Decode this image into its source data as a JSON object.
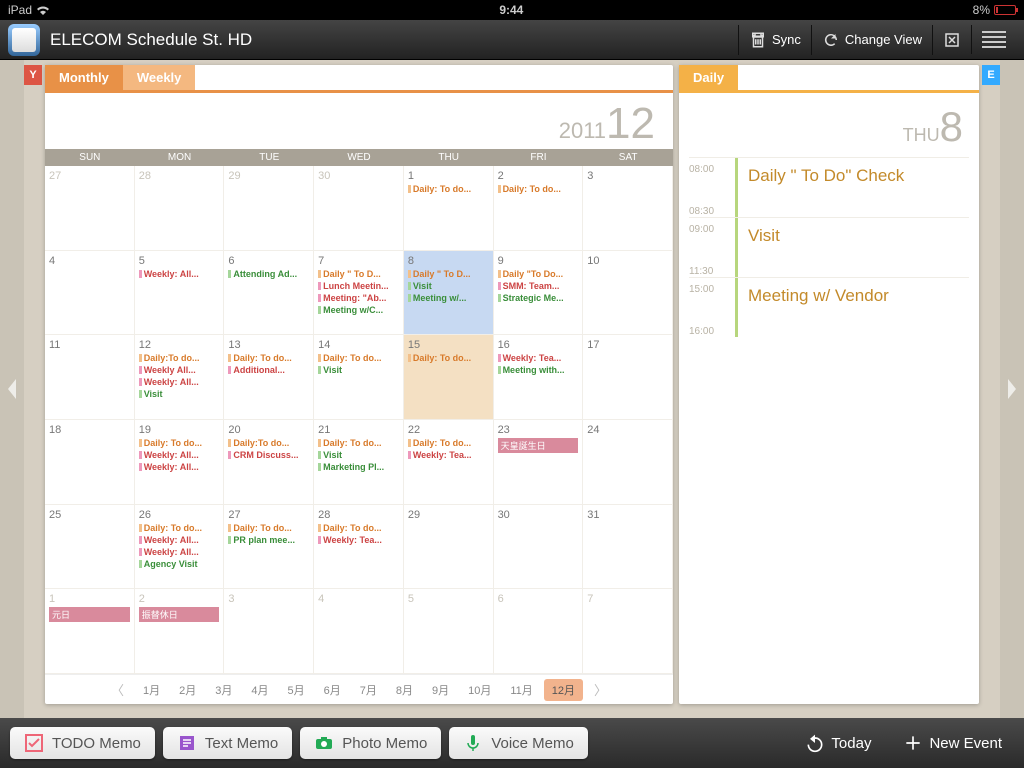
{
  "status": {
    "device": "iPad",
    "time": "9:44",
    "battery": "8%"
  },
  "header": {
    "title": "ELECOM Schedule St. HD",
    "sync": "Sync",
    "change_view": "Change View"
  },
  "left_tab": "Y",
  "right_tab": "E",
  "month": {
    "tabs": {
      "monthly": "Monthly",
      "weekly": "Weekly"
    },
    "year": "2011",
    "mon": "12",
    "dow": [
      "SUN",
      "MON",
      "TUE",
      "WED",
      "THU",
      "FRI",
      "SAT"
    ],
    "nav": [
      "1月",
      "2月",
      "3月",
      "4月",
      "5月",
      "6月",
      "7月",
      "8月",
      "9月",
      "10月",
      "11月",
      "12月"
    ],
    "cells": [
      {
        "n": "27",
        "dim": true
      },
      {
        "n": "28",
        "dim": true
      },
      {
        "n": "29",
        "dim": true
      },
      {
        "n": "30",
        "dim": true
      },
      {
        "n": "1",
        "ev": [
          {
            "c": "ora",
            "t": "Daily: To do..."
          }
        ]
      },
      {
        "n": "2",
        "ev": [
          {
            "c": "ora",
            "t": "Daily: To do..."
          }
        ]
      },
      {
        "n": "3"
      },
      {
        "n": "4"
      },
      {
        "n": "5",
        "ev": [
          {
            "c": "red",
            "t": "Weekly: All..."
          }
        ]
      },
      {
        "n": "6",
        "ev": [
          {
            "c": "grn",
            "t": "Attending Ad..."
          }
        ]
      },
      {
        "n": "7",
        "ev": [
          {
            "c": "ora",
            "t": "Daily \" To D..."
          },
          {
            "c": "red",
            "t": "Lunch Meetin..."
          },
          {
            "c": "red",
            "t": "Meeting: \"Ab..."
          },
          {
            "c": "grn",
            "t": "Meeting w/C..."
          }
        ]
      },
      {
        "n": "8",
        "sel": true,
        "ev": [
          {
            "c": "ora",
            "t": "Daily \" To D..."
          },
          {
            "c": "grn",
            "t": "Visit"
          },
          {
            "c": "grn",
            "t": "Meeting w/..."
          }
        ]
      },
      {
        "n": "9",
        "ev": [
          {
            "c": "ora",
            "t": "Daily \"To Do..."
          },
          {
            "c": "red",
            "t": "SMM: Team..."
          },
          {
            "c": "grn",
            "t": "Strategic Me..."
          }
        ]
      },
      {
        "n": "10"
      },
      {
        "n": "11"
      },
      {
        "n": "12",
        "ev": [
          {
            "c": "ora",
            "t": "Daily:To do..."
          },
          {
            "c": "red",
            "t": "Weekly All..."
          },
          {
            "c": "red",
            "t": "Weekly: All..."
          },
          {
            "c": "grn",
            "t": "Visit"
          }
        ]
      },
      {
        "n": "13",
        "ev": [
          {
            "c": "ora",
            "t": "Daily: To do..."
          },
          {
            "c": "red",
            "t": "Additional..."
          }
        ]
      },
      {
        "n": "14",
        "ev": [
          {
            "c": "ora",
            "t": "Daily: To do..."
          },
          {
            "c": "grn",
            "t": "Visit"
          }
        ]
      },
      {
        "n": "15",
        "shade": true,
        "ev": [
          {
            "c": "ora",
            "t": "Daily: To do..."
          }
        ]
      },
      {
        "n": "16",
        "ev": [
          {
            "c": "red",
            "t": "Weekly: Tea..."
          },
          {
            "c": "grn",
            "t": "Meeting with..."
          }
        ]
      },
      {
        "n": "17"
      },
      {
        "n": "18"
      },
      {
        "n": "19",
        "ev": [
          {
            "c": "ora",
            "t": "Daily: To do..."
          },
          {
            "c": "red",
            "t": "Weekly: All..."
          },
          {
            "c": "red",
            "t": "Weekly: All..."
          }
        ]
      },
      {
        "n": "20",
        "ev": [
          {
            "c": "ora",
            "t": "Daily:To do..."
          },
          {
            "c": "red",
            "t": "CRM Discuss..."
          }
        ]
      },
      {
        "n": "21",
        "ev": [
          {
            "c": "ora",
            "t": "Daily: To do..."
          },
          {
            "c": "grn",
            "t": "Visit"
          },
          {
            "c": "grn",
            "t": "Marketing Pl..."
          }
        ]
      },
      {
        "n": "22",
        "ev": [
          {
            "c": "ora",
            "t": "Daily: To do..."
          },
          {
            "c": "red",
            "t": "Weekly: Tea..."
          }
        ]
      },
      {
        "n": "23",
        "hol": "天皇誕生日"
      },
      {
        "n": "24"
      },
      {
        "n": "25"
      },
      {
        "n": "26",
        "ev": [
          {
            "c": "ora",
            "t": "Daily: To do..."
          },
          {
            "c": "red",
            "t": "Weekly: All..."
          },
          {
            "c": "red",
            "t": "Weekly: All..."
          },
          {
            "c": "grn",
            "t": "Agency Visit"
          }
        ]
      },
      {
        "n": "27",
        "ev": [
          {
            "c": "ora",
            "t": "Daily: To do..."
          },
          {
            "c": "grn",
            "t": "PR plan mee..."
          }
        ]
      },
      {
        "n": "28",
        "ev": [
          {
            "c": "ora",
            "t": "Daily: To do..."
          },
          {
            "c": "red",
            "t": "Weekly: Tea..."
          }
        ]
      },
      {
        "n": "29"
      },
      {
        "n": "30"
      },
      {
        "n": "31"
      },
      {
        "n": "1",
        "dim": true,
        "hol": "元日"
      },
      {
        "n": "2",
        "dim": true,
        "hol": "振替休日"
      },
      {
        "n": "3",
        "dim": true
      },
      {
        "n": "4",
        "dim": true
      },
      {
        "n": "5",
        "dim": true
      },
      {
        "n": "6",
        "dim": true
      },
      {
        "n": "7",
        "dim": true
      }
    ]
  },
  "daily": {
    "tab": "Daily",
    "dow": "THU",
    "num": "8",
    "rows": [
      {
        "t1": "08:00",
        "t2": "08:30",
        "title": "Daily \" To Do\" Check"
      },
      {
        "t1": "09:00",
        "t2": "11:30",
        "title": "Visit"
      },
      {
        "t1": "15:00",
        "t2": "16:00",
        "title": "Meeting w/ Vendor"
      }
    ]
  },
  "bottom": {
    "todo": "TODO Memo",
    "text": "Text Memo",
    "photo": "Photo Memo",
    "voice": "Voice Memo",
    "today": "Today",
    "new": "New Event"
  }
}
